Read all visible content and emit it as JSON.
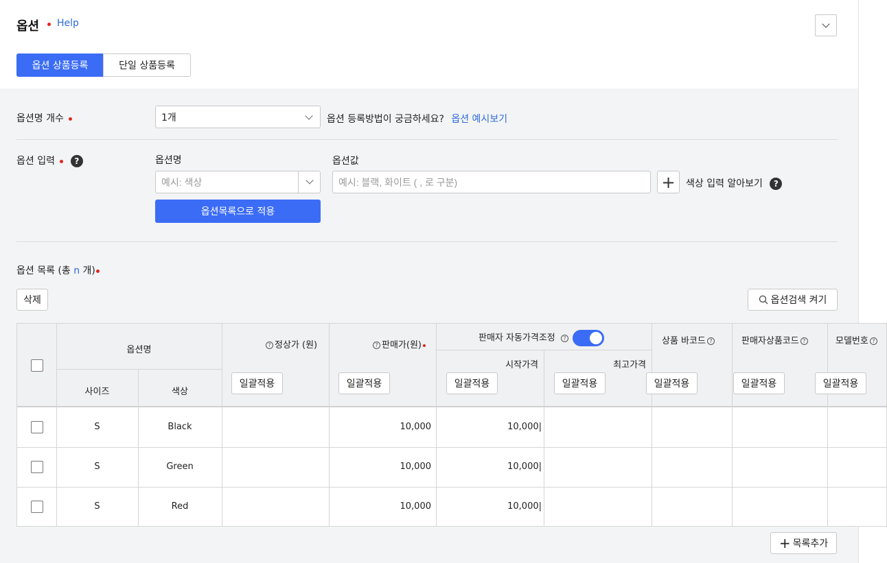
{
  "header": {
    "title": "옵션",
    "help": "Help"
  },
  "tabs": [
    {
      "label": "옵션 상품등록",
      "active": true
    },
    {
      "label": "단일 상품등록",
      "active": false
    }
  ],
  "option_count": {
    "label": "옵션명 개수",
    "value": "1개",
    "hint": "옵션 등록방법이 궁금하세요?",
    "link": "옵션 예시보기"
  },
  "option_input": {
    "label": "옵션 입력",
    "name_label": "옵션명",
    "name_placeholder": "예시: 색상",
    "value_label": "옵션값",
    "value_placeholder": "예시: 블랙, 화이트 ( , 로 구분)",
    "apply_button": "옵션목록으로 적용",
    "color_help": "색상 입력 알아보기"
  },
  "option_list": {
    "title_prefix": "옵션 목록 (총",
    "count": "n",
    "title_suffix": "개)",
    "delete_button": "삭제",
    "search_button": "옵션검색 켜기",
    "add_button": "목록추가"
  },
  "table": {
    "headers": {
      "option_name": "옵션명",
      "size": "사이즈",
      "color": "색상",
      "regular_price": "정상가 (원)",
      "sale_price": "판매가(원)",
      "auto_price": "판매자 자동가격조정",
      "start_price": "시작가격",
      "max_price": "최고가격",
      "barcode": "상품 바코드",
      "seller_code": "판매자상품코드",
      "model_no": "모델번호"
    },
    "bulk_label": "일괄적용",
    "bulk_label_clipped": "일괄적용",
    "rows": [
      {
        "size": "S",
        "color": "Black",
        "regular": "",
        "sale": "10,000",
        "start": "10,000|",
        "max": "",
        "barcode": "",
        "code": "",
        "model": ""
      },
      {
        "size": "S",
        "color": "Green",
        "regular": "",
        "sale": "10,000",
        "start": "10,000|",
        "max": "",
        "barcode": "",
        "code": "",
        "model": ""
      },
      {
        "size": "S",
        "color": "Red",
        "regular": "",
        "sale": "10,000",
        "start": "10,000|",
        "max": "",
        "barcode": "",
        "code": "",
        "model": ""
      }
    ]
  },
  "colors": {
    "accent": "#3b6cf6",
    "link": "#2f6bd8",
    "required": "#e3261d"
  }
}
